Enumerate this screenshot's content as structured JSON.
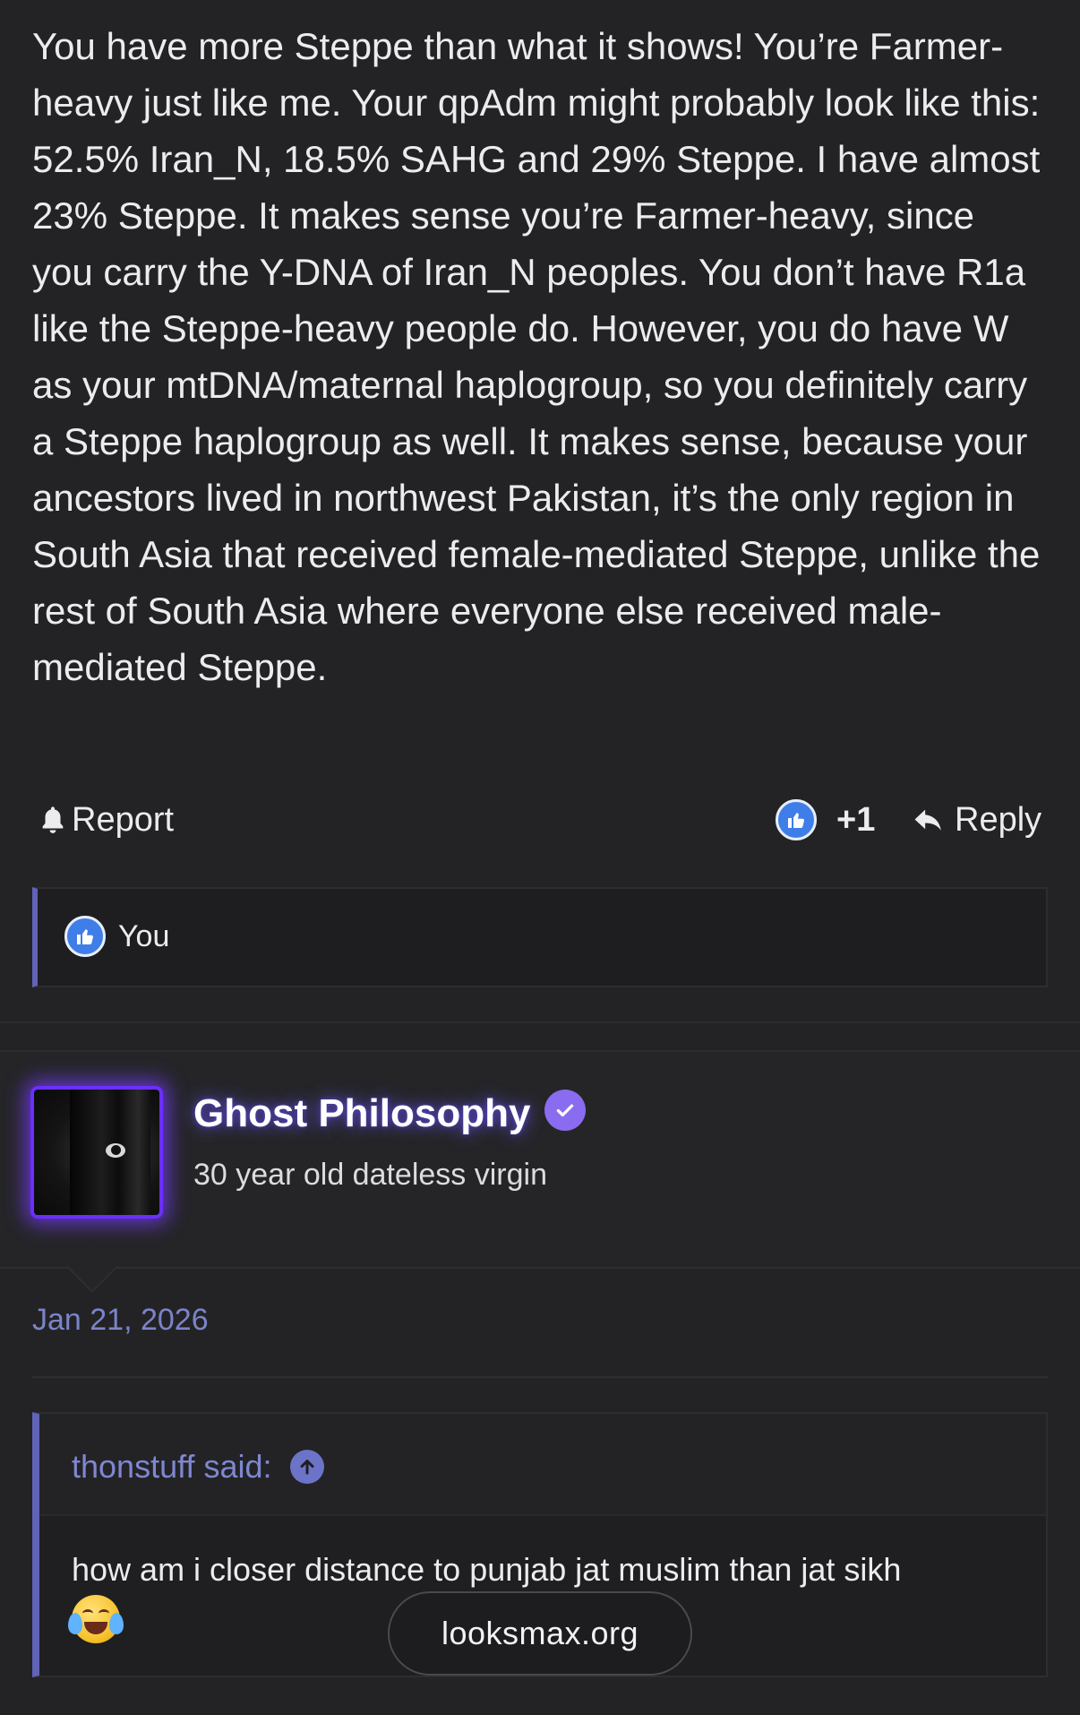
{
  "post": {
    "body": "You have more Steppe than what it shows! You’re Farmer-heavy just like me. Your qpAdm might probably look like this: 52.5% Iran_N, 18.5% SAHG and 29% Steppe. I have almost 23% Steppe. It makes sense you’re Farmer-heavy, since you carry the Y-DNA of Iran_N peoples. You don’t have R1a like the Steppe-heavy people do. However, you do have W as your mtDNA/maternal haplogroup, so you definitely carry a Steppe haplogroup as well. It makes sense, because your ancestors lived in northwest Pakistan, it’s the only region in South Asia that received female-mediated Steppe, unlike the rest of South Asia where everyone else received male-mediated Steppe.",
    "actions": {
      "report_label": "Report",
      "like_count": "+1",
      "reply_label": "Reply"
    },
    "likes_bar": {
      "liked_by": "You"
    }
  },
  "next_post": {
    "username": "Ghost Philosophy",
    "user_title": "30 year old dateless virgin",
    "date": "Jan 21, 2026",
    "quote": {
      "author_line": "thonstuff said:",
      "text": "how am i closer distance to punjab jat muslim than jat sikh"
    }
  },
  "site_badge": "looksmax.org",
  "colors": {
    "background": "#232325",
    "accent": "#6063b8",
    "link": "#7b84c9",
    "like_blue": "#3f7ee8",
    "verified": "#8a6cf0",
    "avatar_glow": "#6b2fff"
  },
  "icons": {
    "report": "bell-icon",
    "like": "thumbs-up-icon",
    "reply": "reply-arrow-icon",
    "verified": "verified-check-icon",
    "quote_jump": "arrow-up-circle-icon",
    "emoji": "crying-laughing-emoji"
  }
}
